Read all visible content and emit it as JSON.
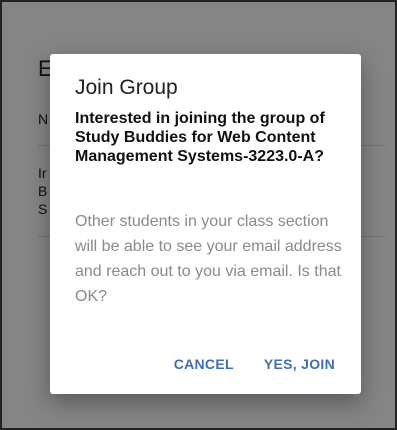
{
  "background": {
    "title_fragment": "E",
    "line1_fragment": "N",
    "line2_fragment": "Ir",
    "line3_fragment": "B",
    "line4_fragment": "S"
  },
  "dialog": {
    "title": "Join Group",
    "question": "Interested in joining the group of Study Buddies for Web Content Management Systems-3223.0-A?",
    "body": "Other students in your class section will be able to see your email address and reach out to you via email. Is that OK?",
    "cancel_label": "CANCEL",
    "confirm_label": "YES, JOIN"
  },
  "colors": {
    "accent": "#3f6fb0",
    "overlay": "rgba(0,0,0,0.48)",
    "body_text": "#8a8a8a"
  }
}
